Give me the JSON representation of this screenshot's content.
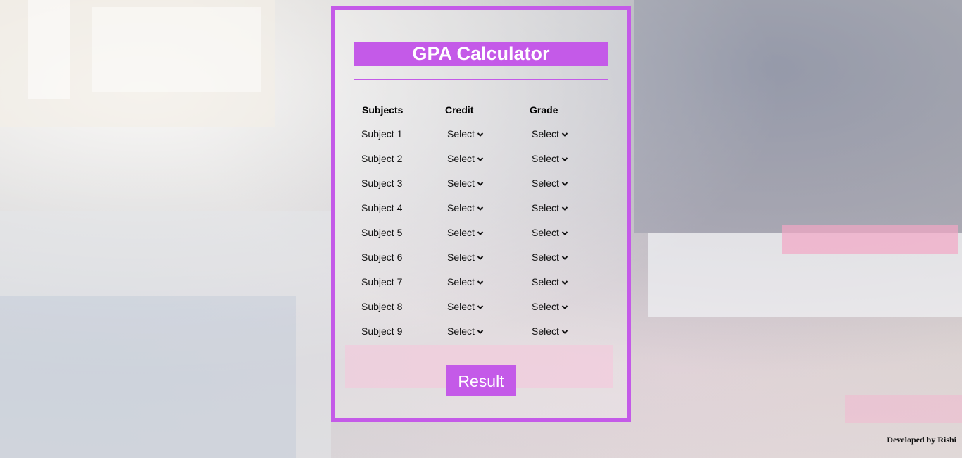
{
  "app": {
    "title": "GPA Calculator",
    "accent_color": "#c45ae8"
  },
  "table": {
    "headers": {
      "subjects": "Subjects",
      "credit": "Credit",
      "grade": "Grade"
    },
    "rows": [
      {
        "subject": "Subject 1",
        "credit": "Select",
        "grade": "Select"
      },
      {
        "subject": "Subject 2",
        "credit": "Select",
        "grade": "Select"
      },
      {
        "subject": "Subject 3",
        "credit": "Select",
        "grade": "Select"
      },
      {
        "subject": "Subject 4",
        "credit": "Select",
        "grade": "Select"
      },
      {
        "subject": "Subject 5",
        "credit": "Select",
        "grade": "Select"
      },
      {
        "subject": "Subject 6",
        "credit": "Select",
        "grade": "Select"
      },
      {
        "subject": "Subject 7",
        "credit": "Select",
        "grade": "Select"
      },
      {
        "subject": "Subject 8",
        "credit": "Select",
        "grade": "Select"
      },
      {
        "subject": "Subject 9",
        "credit": "Select",
        "grade": "Select"
      }
    ]
  },
  "actions": {
    "result_label": "Result"
  },
  "footer": {
    "credit": "Developed by Rishi"
  },
  "icons": {
    "dropdown": "chevron-down-icon"
  }
}
